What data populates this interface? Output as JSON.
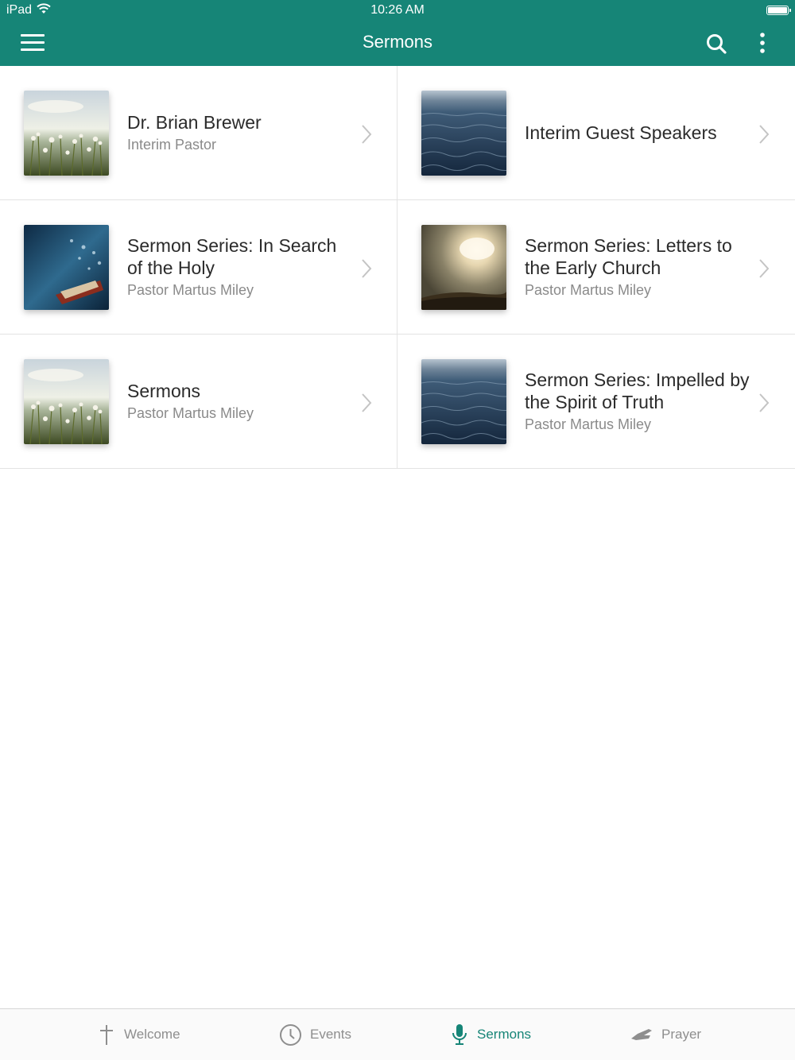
{
  "status_bar": {
    "carrier": "iPad",
    "time": "10:26 AM",
    "icons": [
      "wifi-icon",
      "battery-icon"
    ]
  },
  "header": {
    "title": "Sermons",
    "menu_icon": "hamburger-menu-icon",
    "search_icon": "search-icon",
    "more_icon": "more-vertical-icon",
    "color": "#168577"
  },
  "series": [
    {
      "title": "Dr. Brian Brewer",
      "subtitle": "Interim Pastor",
      "image": "dandelion-field"
    },
    {
      "title": "Interim Guest Speakers",
      "subtitle": "",
      "image": "ocean-waves"
    },
    {
      "title": "Sermon Series: In Search of the Holy",
      "subtitle": "Pastor Martus Miley",
      "image": "boat-on-water"
    },
    {
      "title": "Sermon Series: Letters to the Early Church",
      "subtitle": "Pastor Martus Miley",
      "image": "sunburst-sky"
    },
    {
      "title": "Sermons",
      "subtitle": "Pastor Martus Miley",
      "image": "dandelion-field"
    },
    {
      "title": "Sermon Series: Impelled by the Spirit of Truth",
      "subtitle": "Pastor Martus Miley",
      "image": "ocean-waves"
    }
  ],
  "tabs": [
    {
      "label": "Welcome",
      "icon": "cross-icon",
      "active": false
    },
    {
      "label": "Events",
      "icon": "clock-icon",
      "active": false
    },
    {
      "label": "Sermons",
      "icon": "microphone-icon",
      "active": true
    },
    {
      "label": "Prayer",
      "icon": "praying-hands-icon",
      "active": false
    }
  ],
  "colors": {
    "accent": "#168577",
    "inactive_tab": "#8e8e8e",
    "subtitle": "#8a8a8a"
  }
}
